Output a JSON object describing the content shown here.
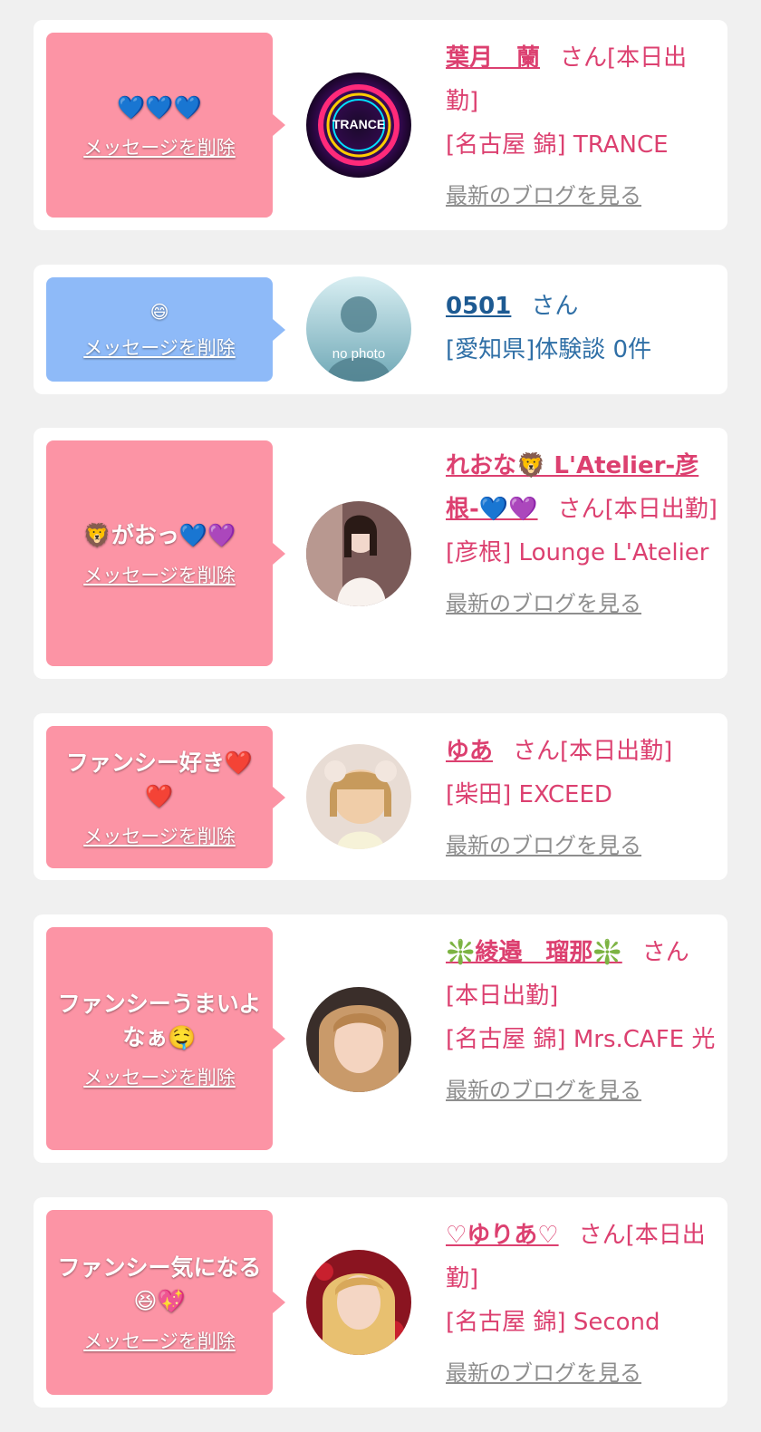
{
  "messages": [
    {
      "message": "💙💙💙",
      "delete_label": "メッセージを削除",
      "name": "葉月　蘭",
      "honorific": "さん",
      "status": "[本日出勤]",
      "shop": "[名古屋 錦] TRANCE",
      "blog_label": "最新のブログを見る"
    },
    {
      "message": "😄",
      "delete_label": "メッセージを削除",
      "name": "0501",
      "honorific": "さん",
      "detail": "[愛知県]体験談 0件",
      "avatar_text": "no photo"
    },
    {
      "message": "🦁がおっ💙💜",
      "delete_label": "メッセージを削除",
      "name": "れおな🦁 L'Atelier-彦根-💙💜",
      "honorific": "さん",
      "status": "[本日出勤]",
      "shop": "[彦根] Lounge L'Atelier",
      "blog_label": "最新のブログを見る"
    },
    {
      "message": "ファンシー好き❤️❤️",
      "delete_label": "メッセージを削除",
      "name": "ゆあ",
      "honorific": "さん",
      "status": "[本日出勤]",
      "shop": "[柴田] EXCEED",
      "blog_label": "最新のブログを見る"
    },
    {
      "message": "ファンシーうまいよなぁ🤤",
      "delete_label": "メッセージを削除",
      "name": "❇️綾邉　瑠那❇️",
      "honorific": "さん",
      "status": "[本日出勤]",
      "shop": "[名古屋 錦] Mrs.CAFE 光",
      "blog_label": "最新のブログを見る"
    },
    {
      "message": "ファンシー気になる😆💖",
      "delete_label": "メッセージを削除",
      "name": "♡ゆりあ♡",
      "honorific": "さん",
      "status": "[本日出勤]",
      "shop": "[名古屋 錦] Second",
      "blog_label": "最新のブログを見る"
    }
  ],
  "colors": {
    "pink_bubble": "#fc94a5",
    "blue_bubble": "#8ebaf8",
    "pink_text": "#dc4070",
    "blue_text": "#1d5a92",
    "background": "#f0f0f0"
  }
}
